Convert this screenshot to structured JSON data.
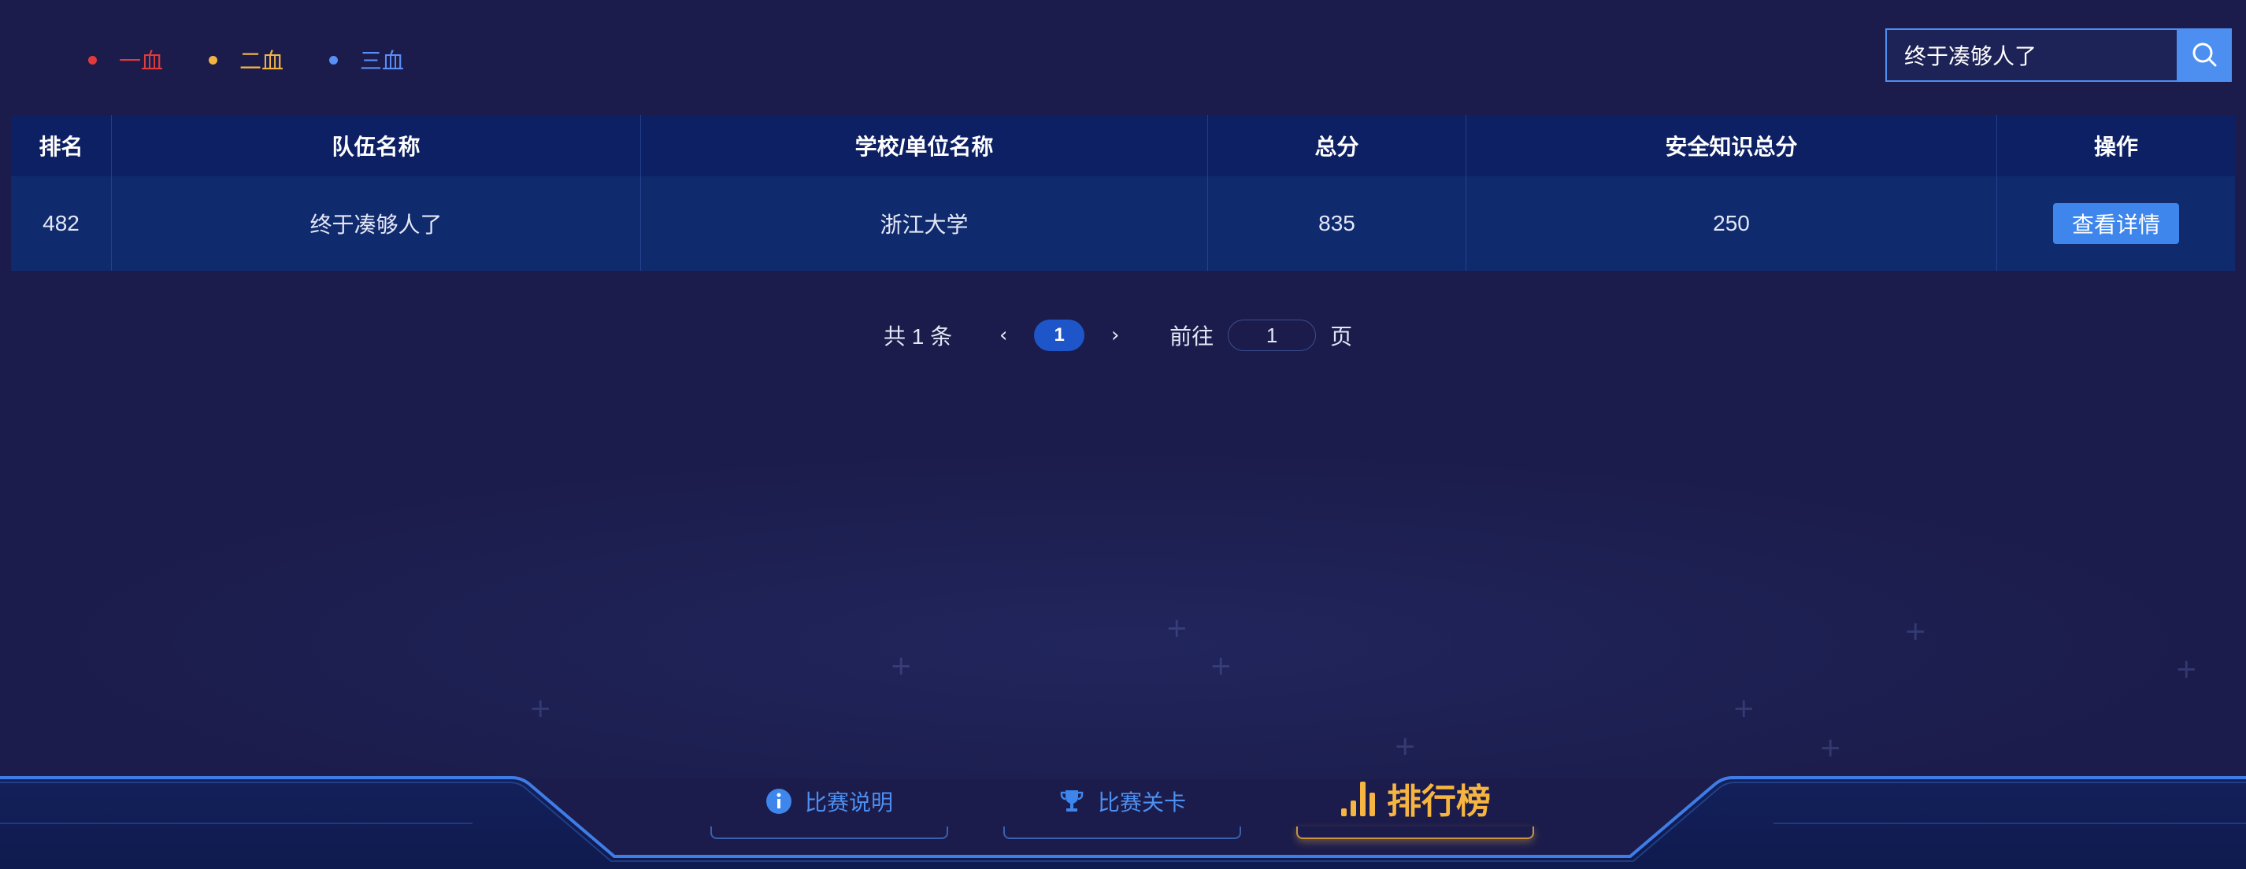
{
  "legend": [
    {
      "label": "一血",
      "color": "#e23a3a"
    },
    {
      "label": "二血",
      "color": "#f1b343"
    },
    {
      "label": "三血",
      "color": "#5a8ff5"
    }
  ],
  "search": {
    "value": "终于凑够人了",
    "placeholder": "",
    "icon": "search-icon"
  },
  "table": {
    "headers": [
      "排名",
      "队伍名称",
      "学校/单位名称",
      "总分",
      "安全知识总分",
      "操作"
    ],
    "rows": [
      {
        "rank": "482",
        "team": "终于凑够人了",
        "school": "浙江大学",
        "total": "835",
        "knowledge": "250",
        "action": "查看详情"
      }
    ]
  },
  "pagination": {
    "total_text": "共 1 条",
    "current_page": "1",
    "goto_label": "前往",
    "goto_value": "1",
    "page_suffix": "页"
  },
  "bottom_nav": [
    {
      "label": "比赛说明",
      "icon": "info-icon",
      "active": false
    },
    {
      "label": "比赛关卡",
      "icon": "trophy-icon",
      "active": false
    },
    {
      "label": "排行榜",
      "icon": "bar-chart-icon",
      "active": true
    }
  ],
  "colors": {
    "background": "#1b1c4b",
    "accent": "#4d8ff0",
    "active_tab": "#f6b440",
    "inactive_tab": "#4d8ff0"
  }
}
